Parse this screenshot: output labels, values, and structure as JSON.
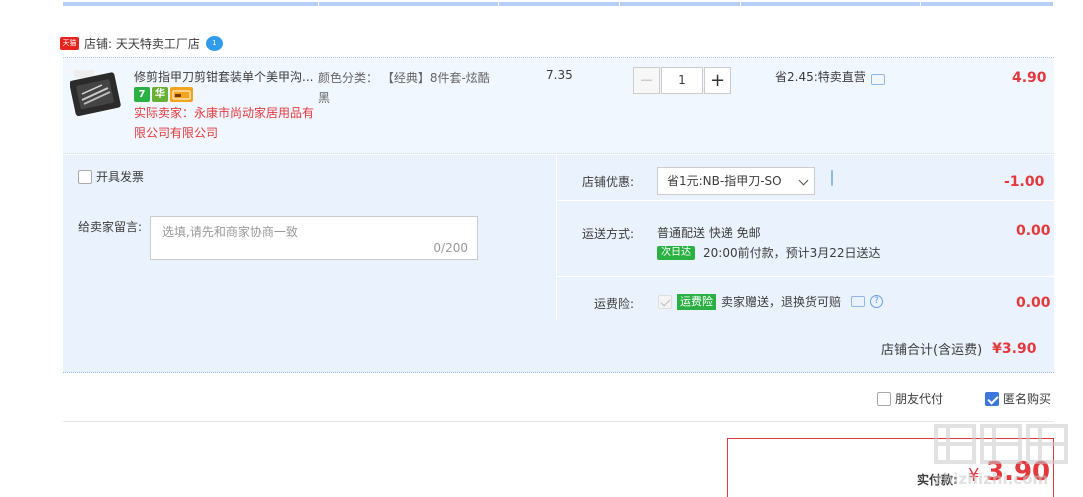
{
  "shop": {
    "platform_badge": "天猫",
    "label": "店铺: 天天特卖工厂店",
    "chat_badge": "1"
  },
  "item": {
    "title": "修剪指甲刀剪钳套装单个美甲沟...",
    "tags": [
      "7",
      "华",
      ""
    ],
    "seller": "实际卖家：永康市尚动家居用品有限公司有限公司",
    "sku_label": "颜色分类：",
    "sku_value": "【经典】8件套-炫酷黑",
    "unit_price": "7.35",
    "quantity": "1",
    "minus": "−",
    "plus": "+",
    "promo": "省2.45:特卖直营",
    "total": "4.90"
  },
  "extras": {
    "invoice_label": "开具发票",
    "memo_label": "给卖家留言:",
    "memo_placeholder": "选填,请先和商家协商一致",
    "memo_count": "0/200",
    "coupon_label": "店铺优惠:",
    "coupon_value": "省1元:NB-指甲刀-SO",
    "coupon_amount": "-1.00",
    "shipping_label": "运送方式:",
    "shipping_value": "普通配送 快递 免邮",
    "shipping_badge": "次日达",
    "shipping_eta": "20:00前付款，预计3月22日送达",
    "shipping_amount": "0.00",
    "insurance_label": "运费险:",
    "insurance_tag": "运费险",
    "insurance_text": "卖家赠送，退换货可赔",
    "insurance_amount": "0.00",
    "qmark": "?"
  },
  "summary": {
    "shop_total_label": "店铺合计(含运费)",
    "shop_total_value": "¥3.90",
    "friend_pay": "朋友代付",
    "anonymous": "匿名购买",
    "paid_label": "实付款:",
    "paid_currency": "¥",
    "paid_value": "3.90"
  },
  "watermark": {
    "text": "zhizhizhi.com"
  }
}
